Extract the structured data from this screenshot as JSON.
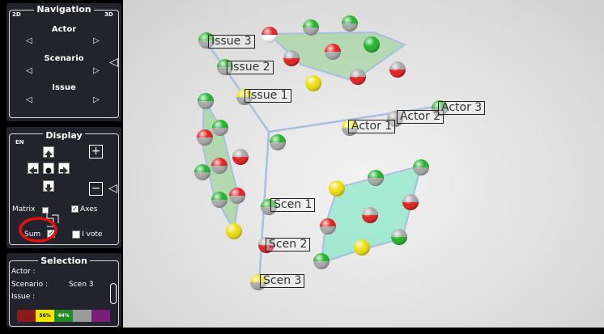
{
  "navigation": {
    "title": "Navigation",
    "left_tag": "2D",
    "right_tag": "3D",
    "rows": [
      {
        "label": "Actor",
        "prev": "◁",
        "next": "▷"
      },
      {
        "label": "Scenario",
        "prev": "◁",
        "next": "▷"
      },
      {
        "label": "Issue",
        "prev": "◁",
        "next": "▷"
      }
    ],
    "collapse": "◁"
  },
  "display": {
    "title": "Display",
    "lang_tag": "EN",
    "zoom_in": "+",
    "zoom_out": "−",
    "collapse": "◁",
    "checkboxes": {
      "matrix": {
        "label": "Matrix",
        "checked": false
      },
      "axes": {
        "label": "Axes",
        "checked": true,
        "mark": "✓"
      },
      "sum": {
        "label": "Sum",
        "checked": true,
        "mark": "✓"
      },
      "ivote": {
        "label": "I vote",
        "checked": false
      }
    }
  },
  "selection": {
    "title": "Selection",
    "actor_label": "Actor :",
    "actor_value": "",
    "scenario_label": "Scenario :",
    "scenario_value": "Scen 3",
    "issue_label": "Issue :",
    "issue_value": "",
    "bars": [
      {
        "text": "",
        "color": "#8b1a1a"
      },
      {
        "text": "56%",
        "color": "#f2e600"
      },
      {
        "text": "44%",
        "color": "#1e8a2a"
      },
      {
        "text": "",
        "color": "#9a9a9a"
      },
      {
        "text": "",
        "color": "#7a1e7a"
      }
    ]
  },
  "view": {
    "labels": {
      "issue3": "Issue 3",
      "issue2": "Issue 2",
      "issue1": "Issue 1",
      "actor1": "Actor 1",
      "actor2": "Actor 2",
      "actor3": "Actor 3",
      "scen1": "Scen 1",
      "scen2": "Scen 2",
      "scen3": "Scen 3"
    },
    "colors": {
      "axis": "#a9bfe0",
      "plane_green": "#8fd18a",
      "plane_teal": "#7de8c4",
      "ball_red": "#e02020",
      "ball_green": "#22b32a",
      "ball_yellow": "#eedd11",
      "ball_grey": "#a8a8a8",
      "ball_white": "#ffffff"
    }
  }
}
